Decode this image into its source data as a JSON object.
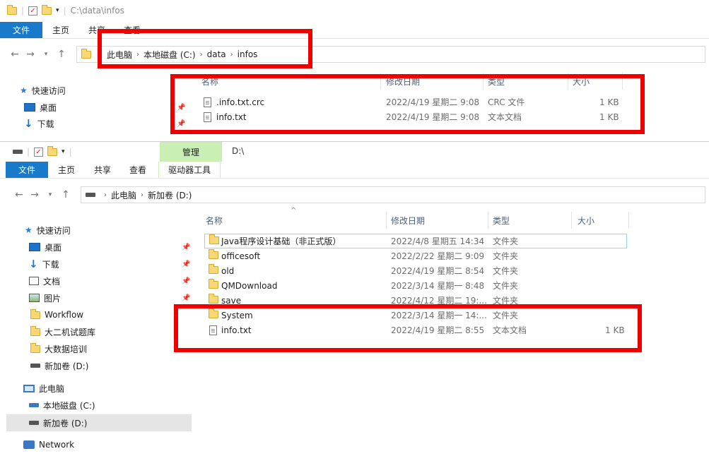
{
  "top": {
    "path": "C:\\data\\infos",
    "tabs": [
      "文件",
      "主页",
      "共享",
      "查看"
    ],
    "breadcrumb": [
      "此电脑",
      "本地磁盘 (C:)",
      "data",
      "infos"
    ],
    "nav": [
      "快速访问",
      "桌面",
      "下载"
    ],
    "columns": [
      "名称",
      "修改日期",
      "类型",
      "大小"
    ],
    "files": [
      {
        "name": ".info.txt.crc",
        "date": "2022/4/19 星期二 9:08",
        "type": "CRC 文件",
        "size": "1 KB"
      },
      {
        "name": "info.txt",
        "date": "2022/4/19 星期二 9:08",
        "type": "文本文档",
        "size": "1 KB"
      }
    ]
  },
  "bottom": {
    "path": "D:\\",
    "manage_tab": "管理",
    "tabs": [
      "文件",
      "主页",
      "共享",
      "查看",
      "驱动器工具"
    ],
    "breadcrumb": [
      "此电脑",
      "新加卷 (D:)"
    ],
    "nav": [
      "快速访问",
      "桌面",
      "下载",
      "文档",
      "图片",
      "Workflow",
      "大二机试题库",
      "大数据培训",
      "新加卷 (D:)",
      "此电脑",
      "本地磁盘 (C:)",
      "新加卷 (D:)",
      "Network"
    ],
    "columns": [
      "名称",
      "修改日期",
      "类型",
      "大小"
    ],
    "files": [
      {
        "name": "Java程序设计基础（非正式版）",
        "date": "2022/4/8 星期五 14:34",
        "type": "文件夹",
        "size": ""
      },
      {
        "name": "officesoft",
        "date": "2022/2/22 星期二 9:09",
        "type": "文件夹",
        "size": ""
      },
      {
        "name": "old",
        "date": "2022/4/19 星期二 8:54",
        "type": "文件夹",
        "size": ""
      },
      {
        "name": "QMDownload",
        "date": "2022/3/14 星期一 8:48",
        "type": "文件夹",
        "size": ""
      },
      {
        "name": "save",
        "date": "2022/4/12 星期二 19:...",
        "type": "文件夹",
        "size": ""
      },
      {
        "name": "System",
        "date": "2022/3/14 星期一 14:...",
        "type": "文件夹",
        "size": ""
      },
      {
        "name": "info.txt",
        "date": "2022/4/19 星期二 8:55",
        "type": "文本文档",
        "size": "1 KB"
      }
    ]
  }
}
